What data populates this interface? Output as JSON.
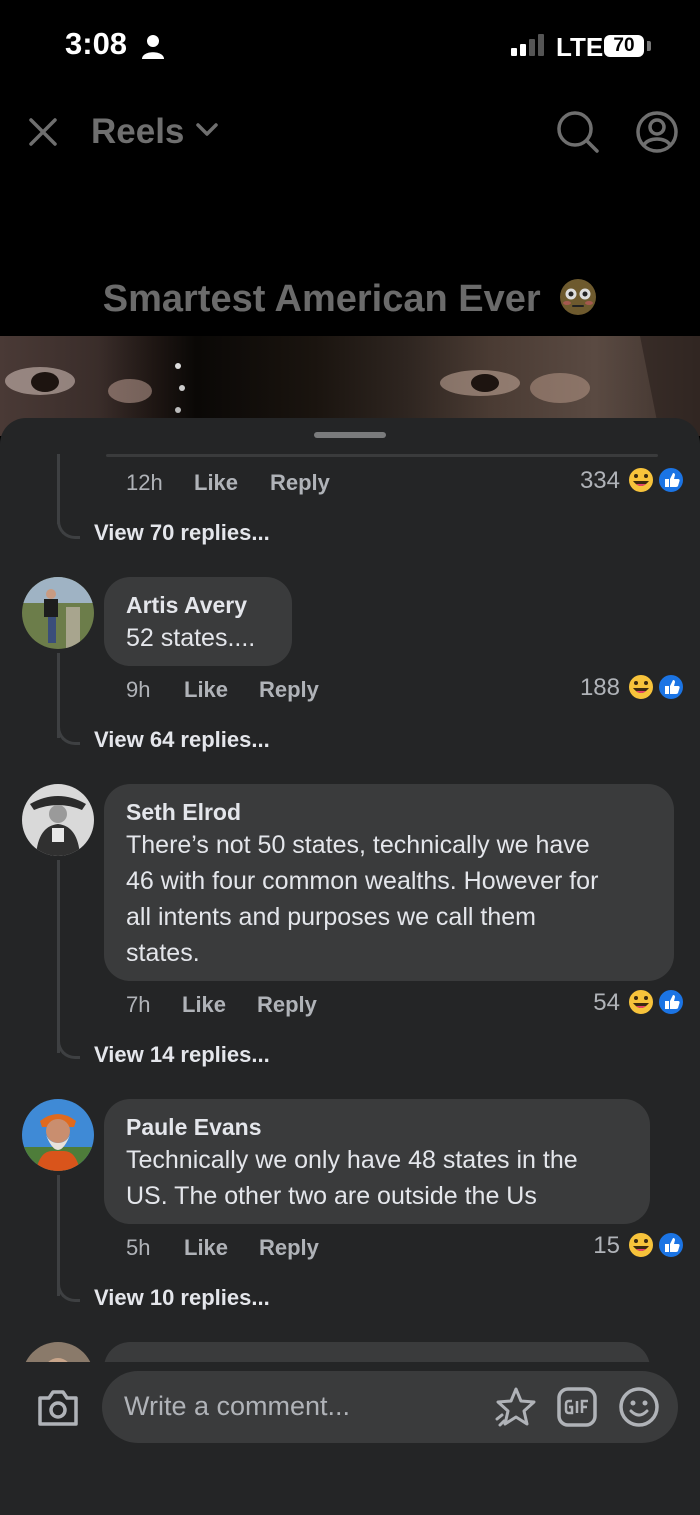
{
  "status_bar": {
    "time": "3:08",
    "network": "LTE",
    "battery": "70"
  },
  "header": {
    "title": "Reels"
  },
  "video": {
    "title": "Smartest American Ever"
  },
  "top_thread": {
    "time": "12h",
    "like": "Like",
    "reply": "Reply",
    "count": "334",
    "view_replies": "View 70 replies..."
  },
  "comments": [
    {
      "name": "Artis Avery",
      "text": "52 states....",
      "time": "9h",
      "like": "Like",
      "reply": "Reply",
      "count": "188",
      "view_replies": "View 64 replies..."
    },
    {
      "name": "Seth Elrod",
      "text_lines": [
        "There’s not 50 states, technically we have",
        "46 with four common wealths. However for",
        "all intents and purposes we call them",
        "states."
      ],
      "time": "7h",
      "like": "Like",
      "reply": "Reply",
      "count": "54",
      "view_replies": "View 14 replies..."
    },
    {
      "name": "Paule Evans",
      "text_lines": [
        "Technically we only have 48 states in the",
        "US. The other two are outside the Us"
      ],
      "time": "5h",
      "like": "Like",
      "reply": "Reply",
      "count": "15",
      "view_replies": "View 10 replies..."
    }
  ],
  "composer": {
    "placeholder": "Write a comment..."
  }
}
